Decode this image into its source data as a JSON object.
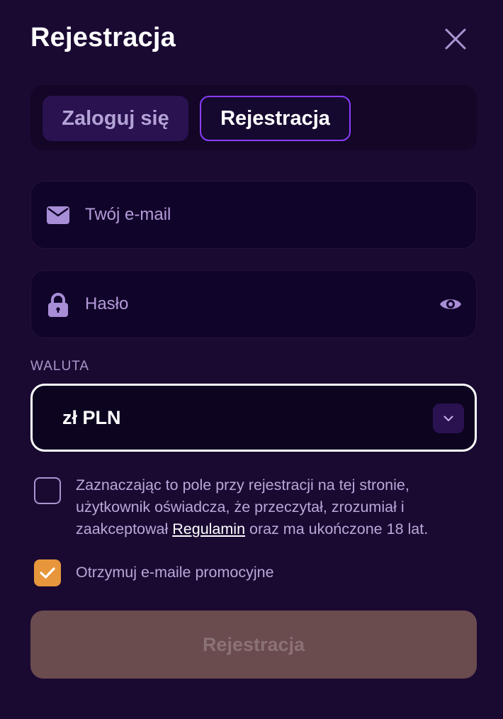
{
  "header": {
    "title": "Rejestracja"
  },
  "tabs": [
    {
      "label": "Zaloguj się",
      "active": false
    },
    {
      "label": "Rejestracja",
      "active": true
    }
  ],
  "email_field": {
    "placeholder": "Twój e-mail",
    "icon": "envelope-icon"
  },
  "password_field": {
    "placeholder": "Hasło",
    "icon": "lock-icon",
    "toggle_icon": "eye-icon"
  },
  "currency": {
    "label": "WALUTA",
    "selected": "zł PLN"
  },
  "terms": {
    "text_before": "Zaznaczając to pole przy rejestracji na tej stronie, użytkownik oświadcza, że przeczytał, zrozumiał i zaakceptował ",
    "link_label": "Regulamin",
    "text_after": " oraz ma ukończone 18 lat.",
    "checked": false
  },
  "promo": {
    "label": "Otrzymuj e-maile promocyjne",
    "checked": true
  },
  "submit": {
    "label": "Rejestracja"
  },
  "colors": {
    "background": "#1a0a32",
    "accent_border": "#8a3dff",
    "checkbox_checked": "#e8963b",
    "submit_disabled": "#6a4b4e"
  }
}
